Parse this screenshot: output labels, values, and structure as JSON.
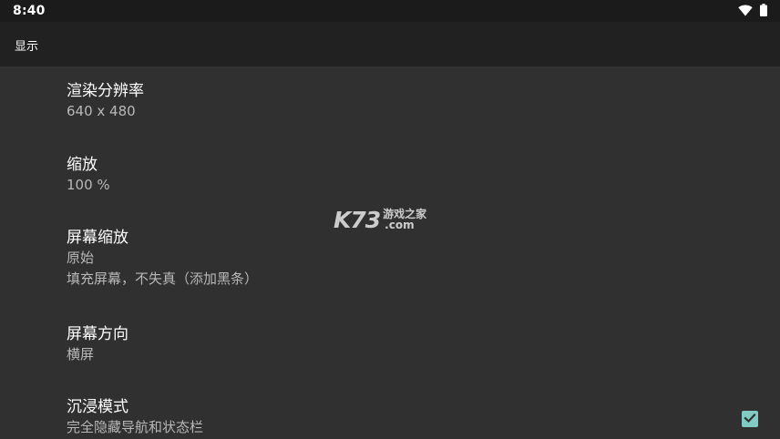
{
  "status_bar": {
    "time": "8:40",
    "icons": [
      "wifi-icon",
      "battery-icon"
    ]
  },
  "app_bar": {
    "title": "显示"
  },
  "preferences": [
    {
      "title": "渲染分辨率",
      "summary": [
        "640 x 480"
      ]
    },
    {
      "title": "缩放",
      "summary": [
        "100 %"
      ]
    },
    {
      "title": "屏幕缩放",
      "summary": [
        "原始",
        "填充屏幕，不失真（添加黑条）"
      ]
    },
    {
      "title": "屏幕方向",
      "summary": [
        "横屏"
      ]
    },
    {
      "title": "沉浸模式",
      "summary": [
        "完全隐藏导航和状态栏"
      ],
      "checked": true
    }
  ],
  "watermark": {
    "logo": "K73",
    "name": "游戏之家",
    "domain": ".com"
  },
  "colors": {
    "background": "#303030",
    "app_bar": "#212121",
    "status_bar": "#1b1b1b",
    "accent": "#80cbc4",
    "summary_text": "#b8b8b8"
  }
}
